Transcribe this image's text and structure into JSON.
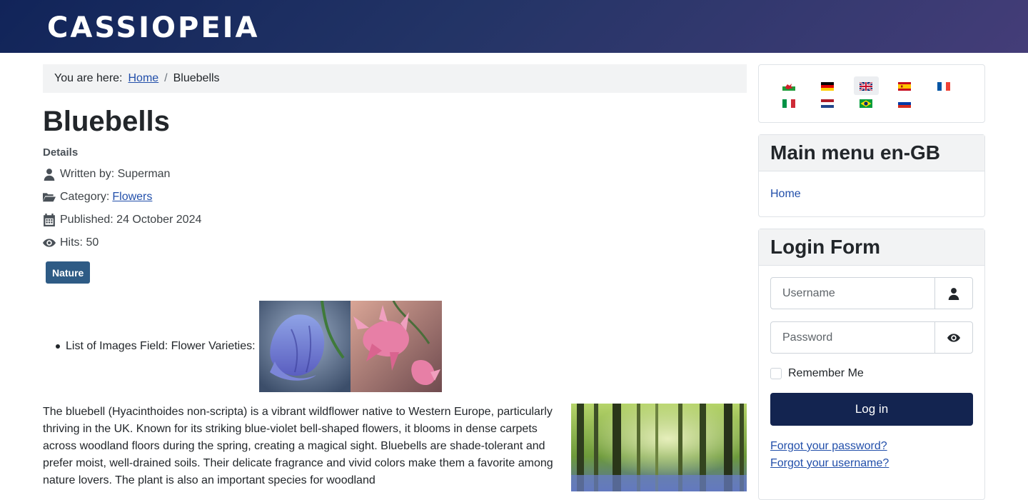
{
  "header": {
    "brand": "CASSIOPEIA"
  },
  "breadcrumb": {
    "label": "You are here:",
    "home": "Home",
    "separator": "/",
    "current": "Bluebells"
  },
  "article": {
    "title": "Bluebells",
    "details_heading": "Details",
    "written_by": "Written by: Superman",
    "category_label": "Category:",
    "category_link": "Flowers",
    "published": "Published: 24 October 2024",
    "hits": "Hits: 50",
    "tag": "Nature",
    "field_label": "List of Images Field: Flower Varieties:",
    "body": "The bluebell (Hyacinthoides non-scripta) is a vibrant wildflower native to Western Europe, particularly thriving in the UK. Known for its striking blue-violet bell-shaped flowers, it blooms in dense carpets across woodland floors during the spring, creating a magical sight. Bluebells are shade-tolerant and prefer moist, well-drained soils. Their delicate fragrance and vivid colors make them a favorite among nature lovers. The plant is also an important species for woodland"
  },
  "languages": [
    {
      "name": "cy-GB",
      "icon": "flag-wales-icon"
    },
    {
      "name": "de-DE",
      "icon": "flag-germany-icon"
    },
    {
      "name": "en-GB",
      "icon": "flag-uk-icon",
      "active": true
    },
    {
      "name": "es-ES",
      "icon": "flag-spain-icon"
    },
    {
      "name": "fr-FR",
      "icon": "flag-france-icon"
    },
    {
      "name": "it-IT",
      "icon": "flag-italy-icon"
    },
    {
      "name": "nl-NL",
      "icon": "flag-netherlands-icon"
    },
    {
      "name": "pt-BR",
      "icon": "flag-brazil-icon"
    },
    {
      "name": "ru-RU",
      "icon": "flag-russia-icon"
    }
  ],
  "main_menu": {
    "title": "Main menu en-GB",
    "items": [
      {
        "label": "Home"
      }
    ]
  },
  "login": {
    "title": "Login Form",
    "username_placeholder": "Username",
    "password_placeholder": "Password",
    "remember": "Remember Me",
    "button": "Log in",
    "forgot_password": "Forgot your password?",
    "forgot_username": "Forgot your username?"
  },
  "colors": {
    "header_start": "#112459",
    "header_end": "#443d78",
    "link": "#224faa",
    "tag": "#2e5b85",
    "button": "#132450"
  }
}
